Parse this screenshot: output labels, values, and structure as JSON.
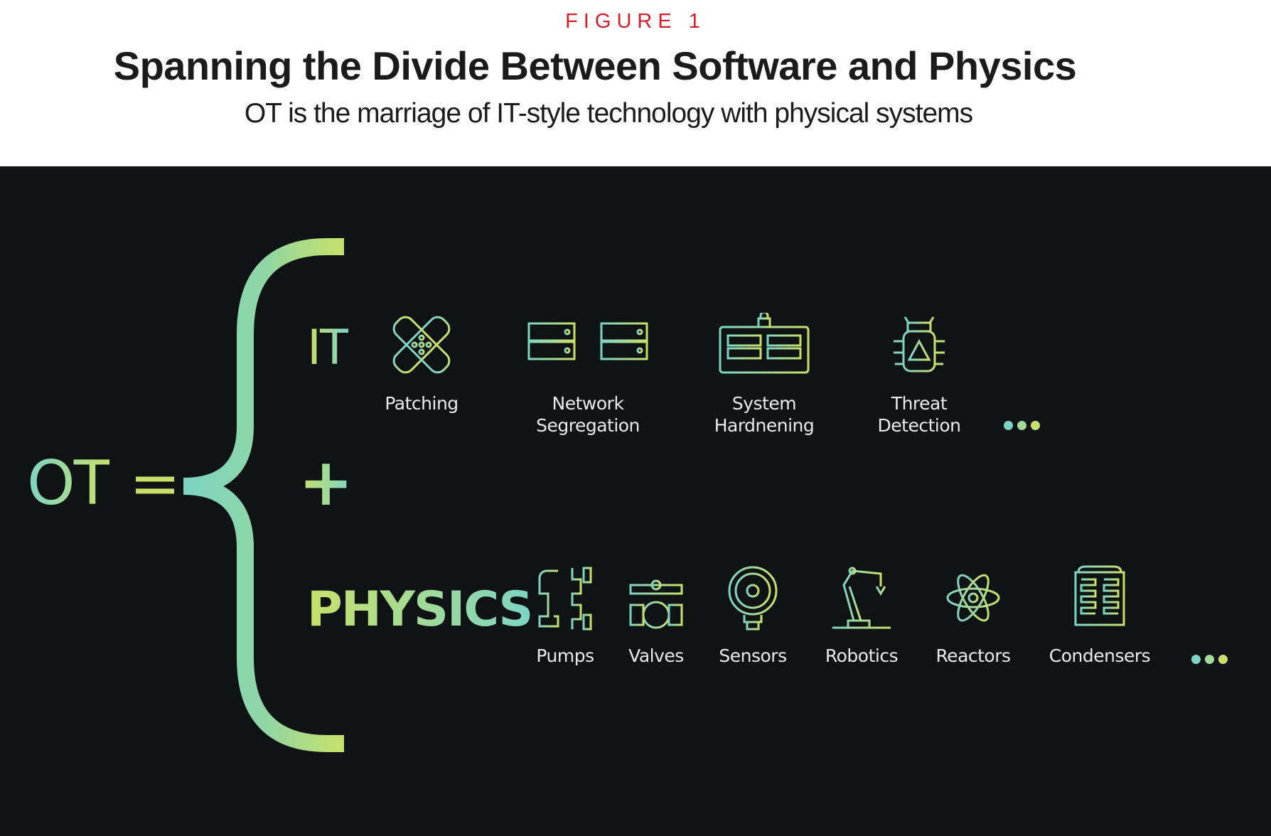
{
  "figure_label": "FIGURE 1",
  "title": "Spanning the Divide Between Software and Physics",
  "subtitle": "OT is the marriage of IT-style technology with physical systems",
  "equation": {
    "lhs": "OT",
    "equals": "=",
    "it": "IT",
    "plus": "+",
    "physics": "PHYSICS"
  },
  "it_items": [
    {
      "label": "Patching",
      "icon": "bandage-icon"
    },
    {
      "label": "Network\nSegregation",
      "icon": "server-racks-icon"
    },
    {
      "label": "System\nHardnening",
      "icon": "locked-server-icon"
    },
    {
      "label": "Threat\nDetection",
      "icon": "bug-warning-icon"
    }
  ],
  "physics_items": [
    {
      "label": "Pumps",
      "icon": "pipes-icon"
    },
    {
      "label": "Valves",
      "icon": "valve-icon"
    },
    {
      "label": "Sensors",
      "icon": "gauge-sensor-icon"
    },
    {
      "label": "Robotics",
      "icon": "robot-arm-icon"
    },
    {
      "label": "Reactors",
      "icon": "atom-icon"
    },
    {
      "label": "Condensers",
      "icon": "condenser-icon"
    }
  ],
  "colors": {
    "accent_red": "#d21f2b",
    "background_dark": "#0f1314",
    "gradient_start": "#7dd4c4",
    "gradient_end": "#c7e16a"
  }
}
